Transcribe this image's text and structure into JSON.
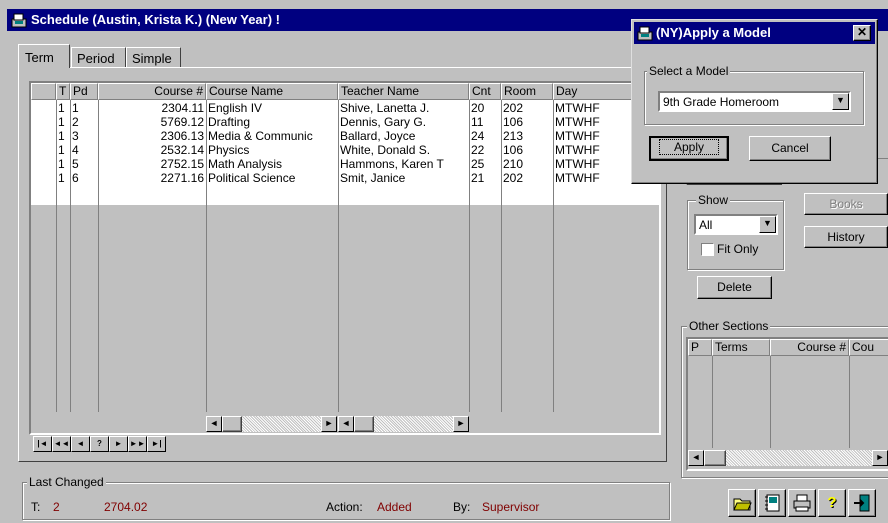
{
  "window": {
    "title": "Schedule (Austin, Krista K.) (New Year) !"
  },
  "tabs": [
    "Term",
    "Period",
    "Simple"
  ],
  "grid": {
    "columns": [
      "T",
      "Pd",
      "Course #",
      "Course Name",
      "Teacher Name",
      "Cnt",
      "Room",
      "Day"
    ],
    "rows": [
      [
        "1",
        "1",
        "2304.11",
        "English IV",
        "Shive, Lanetta J.",
        "20",
        "202",
        "MTWHF"
      ],
      [
        "1",
        "2",
        "5769.12",
        "Drafting",
        "Dennis, Gary G.",
        "11",
        "106",
        "MTWHF"
      ],
      [
        "1",
        "3",
        "2306.13",
        "Media & Communic",
        "Ballard, Joyce",
        "24",
        "213",
        "MTWHF"
      ],
      [
        "1",
        "4",
        "2532.14",
        "Physics",
        "White, Donald S.",
        "22",
        "106",
        "MTWHF"
      ],
      [
        "1",
        "5",
        "2752.15",
        "Math Analysis",
        "Hammons, Karen T",
        "25",
        "210",
        "MTWHF"
      ],
      [
        "1",
        "6",
        "2271.16",
        "Political Science",
        "Smit, Janice",
        "21",
        "202",
        "MTWHF"
      ]
    ]
  },
  "navigator": [
    "|◄",
    "◄◄",
    "◄",
    "?",
    "►",
    "►►",
    "►|"
  ],
  "show": {
    "label": "Show",
    "value": "All",
    "fit_only": "Fit Only"
  },
  "buttons": {
    "delete": "Delete",
    "books": "Books",
    "history": "History"
  },
  "other_sections": {
    "label": "Other Sections",
    "columns": [
      "P",
      "Terms",
      "Course #",
      "Cou"
    ]
  },
  "last_changed": {
    "label": "Last Changed",
    "t_label": "T:",
    "t_value": "2",
    "course": "2704.02",
    "action_label": "Action:",
    "action_value": "Added",
    "by_label": "By:",
    "by_value": "Supervisor"
  },
  "dialog": {
    "title": "(NY)Apply a Model",
    "group_label": "Select a Model",
    "selected": "9th Grade Homeroom",
    "apply": "Apply",
    "cancel": "Cancel"
  }
}
